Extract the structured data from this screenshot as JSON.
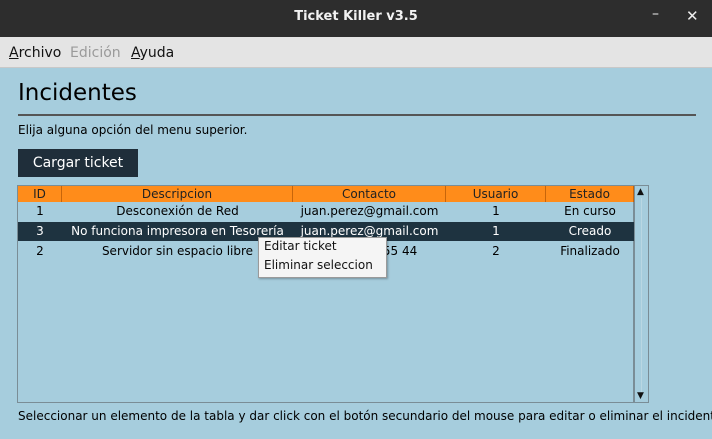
{
  "window": {
    "title": "Ticket Killer v3.5",
    "min_glyph": "–",
    "close_glyph": "✕"
  },
  "menubar": {
    "items": [
      {
        "label_rest": "rchivo",
        "mnemonic": "A",
        "enabled": true
      },
      {
        "label": "Edición",
        "enabled": false
      },
      {
        "label_rest": "yuda",
        "mnemonic": "A",
        "enabled": true
      }
    ]
  },
  "main": {
    "heading": "Incidentes",
    "instruction": "Elija alguna opción del menu superior.",
    "load_button": "Cargar ticket"
  },
  "table": {
    "columns": [
      "ID",
      "Descripcion",
      "Contacto",
      "Usuario",
      "Estado"
    ],
    "rows": [
      {
        "id": "1",
        "descripcion": "Desconexión de Red",
        "contacto": "juan.perez@gmail.com",
        "usuario": "1",
        "estado": "En curso"
      },
      {
        "id": "3",
        "descripcion": "No funciona impresora en Tesorería",
        "contacto": "juan.perez@gmail.com",
        "usuario": "1",
        "estado": "Creado",
        "selected": true
      },
      {
        "id": "2",
        "descripcion": "Servidor sin espacio libre",
        "contacto": "4  555 44",
        "usuario": "2",
        "estado": "Finalizado"
      }
    ]
  },
  "context_menu": {
    "items": [
      "Editar ticket",
      "Eliminar seleccion"
    ]
  },
  "footer": {
    "text": "Seleccionar un elemento de la tabla y dar click con el botón secundario del mouse para editar o eliminar el incidente."
  },
  "colors": {
    "background": "#a6cddd",
    "header": "#ff8c1a",
    "selected": "#1e3340",
    "button": "#1f2e3a"
  }
}
